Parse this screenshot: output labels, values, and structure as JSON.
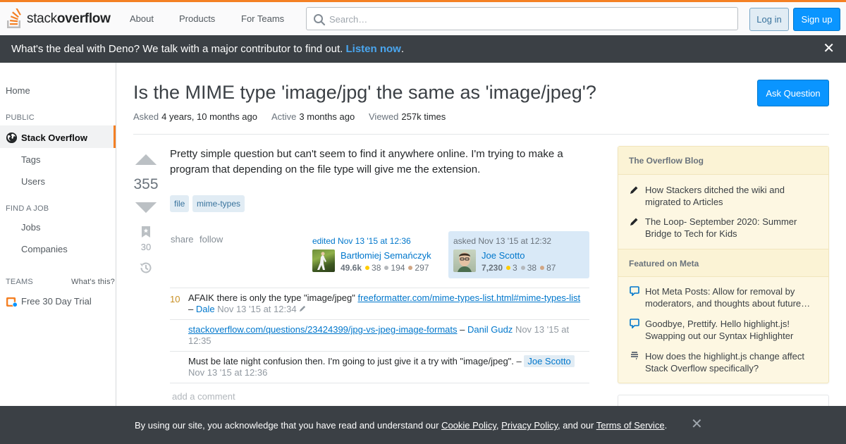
{
  "header": {
    "logo_stack": "stack",
    "logo_overflow": "overflow",
    "nav": [
      "About",
      "Products",
      "For Teams"
    ],
    "search_placeholder": "Search…",
    "login": "Log in",
    "signup": "Sign up",
    "accent_color": "#f48024"
  },
  "promo": {
    "text": "What's the deal with Deno? We talk with a major contributor to find out.",
    "link": "Listen now",
    "period": ".",
    "close": "✕"
  },
  "sidebar": {
    "home": "Home",
    "public_head": "PUBLIC",
    "stack_overflow": "Stack Overflow",
    "tags": "Tags",
    "users": "Users",
    "job_head": "FIND A JOB",
    "jobs": "Jobs",
    "companies": "Companies",
    "teams_head": "TEAMS",
    "whats_this": "What's this?",
    "trial": "Free 30 Day Trial"
  },
  "question": {
    "title": "Is the MIME type 'image/jpg' the same as 'image/jpeg'?",
    "ask_button": "Ask Question",
    "asked_label": "Asked",
    "asked_value": "4 years, 10 months ago",
    "active_label": "Active",
    "active_value": "3 months ago",
    "viewed_label": "Viewed",
    "viewed_value": "257k times",
    "score": "355",
    "bookmarks": "30",
    "body": "Pretty simple question but can't seem to find it anywhere online. I'm trying to make a program that depending on the file type will give me the extension.",
    "tags": [
      "file",
      "mime-types"
    ],
    "share": "share",
    "follow": "follow"
  },
  "editor": {
    "action": "edited Nov 13 '15 at 12:36",
    "name": "Bartłomiej Semańczyk",
    "rep": "49.6k",
    "gold": "38",
    "silver": "194",
    "bronze": "297"
  },
  "asker": {
    "action": "asked Nov 13 '15 at 12:32",
    "name": "Joe Scotto",
    "rep": "7,230",
    "gold": "3",
    "silver": "38",
    "bronze": "87"
  },
  "comments": [
    {
      "score": "10",
      "text": "AFAIK there is only the type \"image/jpeg\" ",
      "link": "freeformatter.com/mime-types-list.html#mime-types-list",
      "sep": " – ",
      "user": "Dale",
      "time": "Nov 13 '15 at 12:34"
    },
    {
      "score": "",
      "link": "stackoverflow.com/questions/23424399/jpg-vs-jpeg-image-formats",
      "sep": " – ",
      "user": "Danil Gudz",
      "time": "Nov 13 '15 at 12:35"
    },
    {
      "score": "",
      "text": "Must be late night confusion then. I'm going to just give it a try with \"image/jpeg\". – ",
      "user": "Joe Scotto",
      "time": "Nov 13 '15 at 12:36"
    }
  ],
  "add_comment": "add a comment",
  "blog": {
    "head1": "The Overflow Blog",
    "items1": [
      "How Stackers ditched the wiki and migrated to Articles",
      "The Loop- September 2020: Summer Bridge to Tech for Kids"
    ],
    "head2": "Featured on Meta",
    "items2": [
      "Hot Meta Posts: Allow for removal by moderators, and thoughts about future…",
      "Goodbye, Prettify. Hello highlight.js! Swapping out our Syntax Highlighter",
      "How does the highlight.js change affect Stack Overflow specifically?"
    ]
  },
  "cookie": {
    "t1": "By using our site, you acknowledge that you have read and understand our ",
    "l1": "Cookie Policy",
    "t2": ", ",
    "l2": "Privacy Policy",
    "t3": ", and our ",
    "l3": "Terms of Service",
    "t4": ".",
    "close": "✕"
  }
}
